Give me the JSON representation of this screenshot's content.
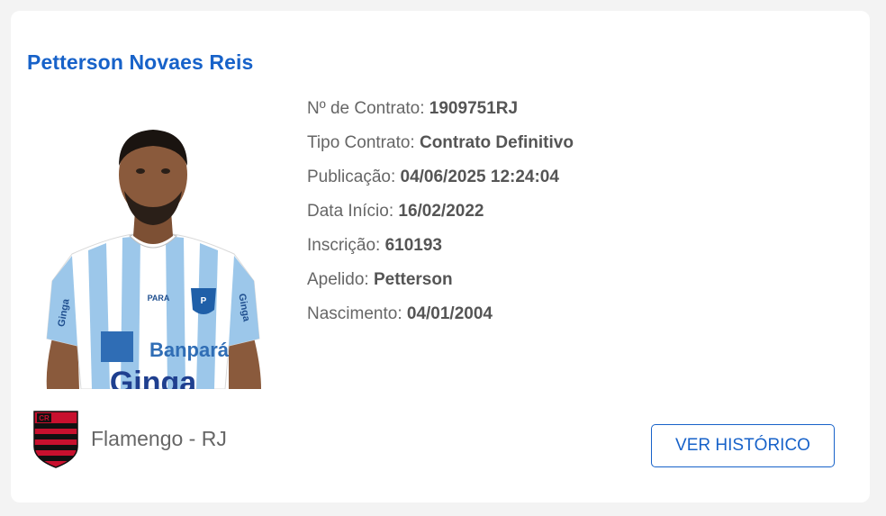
{
  "player": {
    "name": "Petterson Novaes Reis"
  },
  "contract": {
    "rows": [
      {
        "label": "Nº de Contrato:",
        "value": "1909751RJ"
      },
      {
        "label": "Tipo Contrato:",
        "value": "Contrato Definitivo"
      },
      {
        "label": "Publicação:",
        "value": "04/06/2025 12:24:04"
      },
      {
        "label": "Data Início:",
        "value": "16/02/2022"
      },
      {
        "label": "Inscrição:",
        "value": "610193"
      },
      {
        "label": "Apelido:",
        "value": "Petterson"
      },
      {
        "label": "Nascimento:",
        "value": "04/01/2004"
      }
    ]
  },
  "club": {
    "name": "Flamengo - RJ",
    "crest_icon": "flamengo-crest-icon"
  },
  "jersey": {
    "sponsor_top": "Ginga",
    "sponsor_chest": "Banpará",
    "sponsor_bottom": "Ginga",
    "crest_text": "PARA"
  },
  "actions": {
    "history_label": "VER HISTÓRICO"
  },
  "colors": {
    "accent": "#1762c9",
    "jersey_blue": "#9cc7ea",
    "crest_red": "#c8102e",
    "crest_black": "#111111"
  }
}
